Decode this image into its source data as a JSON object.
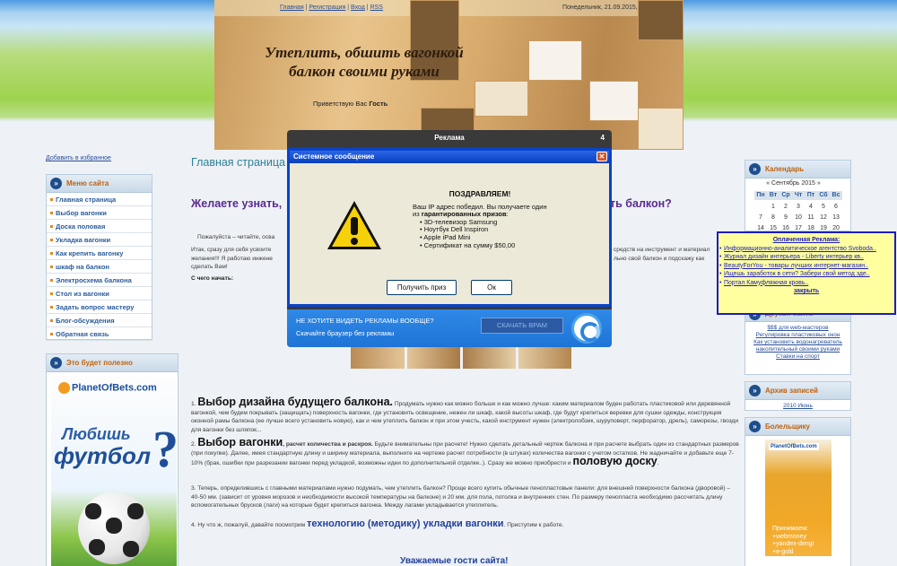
{
  "header": {
    "links": [
      "Главная",
      "Регистрация",
      "Вход",
      "RSS"
    ],
    "date": "Понедельник, 21.09.2015, 19:09",
    "title": "Утеплить, обшить вагонкой балкон своими руками",
    "greeting": "Приветствую Вас",
    "guest": "Гость"
  },
  "left": {
    "favorites": "Добавить в избранное",
    "menu_title": "Меню сайта",
    "menu": [
      "Главная страница",
      "Выбор вагонки",
      "Доска половая",
      "Укладка вагонки",
      "Как крепить вагонку",
      "шкаф на балкон",
      "Электросхема балкона",
      "Стол из вагонки",
      "Задать вопрос мастеру",
      "Блог-обсуждения",
      "Обратная связь"
    ],
    "useful_title": "Это будет полезно",
    "ad_brand": "PlanetOfBets.com",
    "ad_line1": "Любишь",
    "ad_line2": "футбол",
    "ad_q": "?"
  },
  "main": {
    "breadcrumb": "Главная страница",
    "title_left": "Желаете узнать,",
    "title_right": "ть балкон?",
    "intro": "Пожалуйста – читайте, осва",
    "para1_left": "Итак, сразу для себя усвоите\nжелания!!! Я работаю инжене\nсделать Вам!",
    "para1_right": "средств на инструмент и материал\nльно свой балкон и подскажу как",
    "start": "С чего начать:",
    "s1_num": "1.",
    "s1_head": "Выбор дизайна будущего балкона.",
    "s1_text": "Продумать нужно как можно больше и как можно лучше: каким материалом буден работать пластиковой или деревянной вагонкой, чем будем покрывать (защищать) поверхность вагонки, где установить освещение, нежен ли шкаф, какой высоты шкаф, где будут крепиться веревки для сушки одежды, конструкция оконной рамы балкона (ее лучше всего установить новую), как и чем утеплить балкон и при этом учесть, какой инструмент нужен (электролобзик, шуруповерт, перфоратор, дрель), саморезы, гвозди для вагонки без шляпок...",
    "s2_num": "2.",
    "s2_head": "Выбор вагонки",
    "s2_sub": ", расчет количества и раскроя.",
    "s2_text": "Будьте внимательны при расчете! Нужно сделать детальный чертеж балкона и при расчете выбрать один из стандартных размеров (при покупке). Далее, имея стандартную длину и ширину материала, выполните на чертеже расчет потребности (в штуках) количества вагонки с учетом остатков. Не жадничайте и добавьте еще 7-10% (брак, ошибки при разрезании вагонки перед укладкой, возможны идеи по дополнительной отделке..). Сразу же можно приобрести и",
    "s2_end": "половую доску",
    "s3_text": "3. Теперь, определившись с главными материалами нужно подумать, чем утеплить балкон? Проще всего купить обычные пенопластовые панели: для внешней поверхности балкона (дворовой) – 40-50 мм. (зависит от уровня морозов и необходимости высокой температуры на балконе) и 20 мм. для пола, потолка и внутренних стен. По размеру пенопласта необходимо рассчитать длину вспомогательных брусков (лаги) на которые будет крепиться вагонка. Между лагами укладывается утеплитель.",
    "s4_pre": "4. Ну что ж, пожалуй, давайте посмотрим",
    "s4_link": "технологию (методику) укладки вагонки",
    "s4_post": ". Приступим к работе.",
    "footer_title": "Уважаемые гости сайта!"
  },
  "right": {
    "calendar_title": "Календарь",
    "calendar_nav": "«  Сентябрь 2015  »",
    "weekdays": [
      "Пн",
      "Вт",
      "Ср",
      "Чт",
      "Пт",
      "Сб",
      "Вс"
    ],
    "weeks": [
      [
        "",
        "1",
        "2",
        "3",
        "4",
        "5",
        "6"
      ],
      [
        "7",
        "8",
        "9",
        "10",
        "11",
        "12",
        "13"
      ],
      [
        "14",
        "15",
        "16",
        "17",
        "18",
        "19",
        "20"
      ]
    ],
    "friends_title": "Друзья сайта",
    "friends": [
      "$$$ для web-мастеров",
      "Регулировка пластиковых окон",
      "Как установить водонагреватель накопительный своими руками",
      "Ставки на спорт"
    ],
    "archive_title": "Архив записей",
    "archive_item": "2010 Июнь",
    "fans_title": "Болельщику",
    "fans_brand": "PlanetOfBets.com",
    "fans_text": "Принимаем:\n+webmoney\n+yandex-dengi\n+e-gold"
  },
  "paid_ads": {
    "title": "Оплаченная Реклама:",
    "items": [
      "Информационно-аналитическое агентство Svoboda..",
      "Журнал дизайн интерьера - Liberty интерьер кв..",
      "BeautyForYou - товары лучших интернет-магазин..",
      "Ищешь заработок в сети? Забери свой метод зде..",
      "Портал Камуфляжная кровь.."
    ],
    "close": "закрыть"
  },
  "popup": {
    "header": "Реклама",
    "counter": "4",
    "title": "Системное сообщение",
    "congrats": "ПОЗДРАВЛЯЕМ!",
    "line1": "Ваш IP адрес победил. Вы получаете один",
    "line2_pre": "из ",
    "line2_bold": "гарантированных призов",
    "line2_post": ":",
    "prizes": [
      "• 3D-телевизор Samsung",
      "• Ноутбук Dell Inspiron",
      "• Apple iPad Mini",
      "• Сертификат на сумму $50,00"
    ],
    "get_prize": "Получить приз",
    "ok": "Ок",
    "promo_line1": "НЕ ХОТИТЕ ВИДЕТЬ РЕКЛАМЫ ВООБЩЕ?",
    "promo_line2": "Скачайте браузер без рекламы",
    "download": "СКАЧАТЬ ВРАМ"
  },
  "colors": {
    "popup_title_bar": "#0a3fbd",
    "accent_orange": "#c0620c",
    "link_blue": "#2a4f9c",
    "paid_ad_bg": "#ffffa0"
  }
}
